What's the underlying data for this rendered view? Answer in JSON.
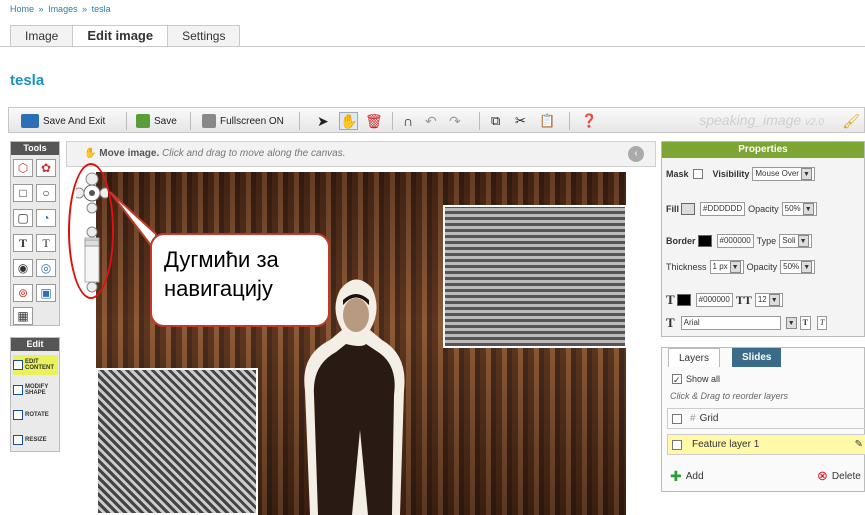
{
  "breadcrumb": {
    "home": "Home",
    "sep1": "»",
    "images": "Images",
    "sep2": "»",
    "current": "tesla"
  },
  "tabs": [
    {
      "label": "Image"
    },
    {
      "label": "Edit image"
    },
    {
      "label": "Settings"
    }
  ],
  "page_title": "tesla",
  "toolbar": {
    "save_exit": "Save And Exit",
    "save": "Save",
    "fullscreen": "Fullscreen ON",
    "brand": "speaking_image",
    "version": "v2.0"
  },
  "tools_panel": {
    "title": "Tools"
  },
  "edit_panel": {
    "title": "Edit",
    "buttons": [
      "EDIT CONTENT",
      "MODIFY SHAPE",
      "ROTATE",
      "RESIZE"
    ]
  },
  "canvas": {
    "mode": "Move image.",
    "hint": "Click and drag to move along the canvas."
  },
  "callout": {
    "line1": "Дугмићи за",
    "line2": "навигацију"
  },
  "properties": {
    "title": "Properties",
    "mask_label": "Mask",
    "visibility_label": "Visibility",
    "visibility_value": "Mouse Over",
    "fill_label": "Fill",
    "fill_value": "#DDDDDD",
    "fill_color": "#DDDDDD",
    "opacity_label": "Opacity",
    "fill_opacity": "50%",
    "border_label": "Border",
    "border_value": "#000000",
    "border_color": "#000000",
    "type_label": "Type",
    "type_value": "Soli",
    "thickness_label": "Thickness",
    "thickness_value": "1 px",
    "border_opacity": "50%",
    "text_color": "#000000",
    "font_size": "12",
    "font_family": "Arial"
  },
  "layers": {
    "tab_layers": "Layers",
    "tab_slides": "Slides",
    "show_all": "Show all",
    "hint": "Click & Drag to reorder layers",
    "rows": [
      {
        "name": "Grid"
      },
      {
        "name": "Feature layer 1"
      }
    ],
    "add": "Add",
    "delete": "Delete"
  },
  "colors": {
    "accent_green": "#7da533",
    "link_blue": "#1b8fc6",
    "callout_red": "#d11111"
  }
}
